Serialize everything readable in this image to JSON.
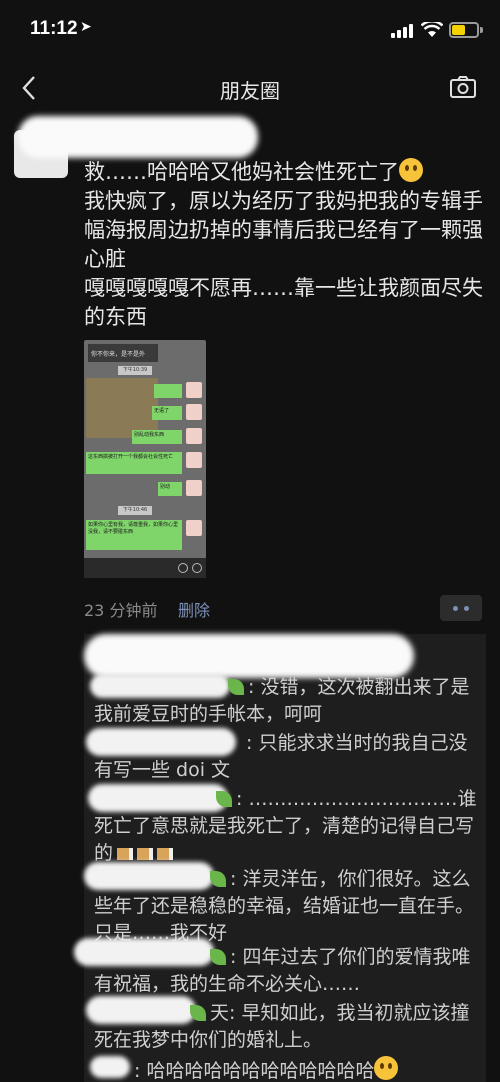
{
  "status_bar": {
    "time": "11:12"
  },
  "nav": {
    "title": "朋友圈"
  },
  "post": {
    "lines": [
      "救……哈哈哈又他妈社会性死亡了",
      "我快疯了，原以为经历了我妈把我的专辑手幅海报周边扔掉的事情后我已经有了一颗强心脏",
      "嘎嘎嘎嘎嘎不愿再……靠一些让我颜面尽失的东西"
    ],
    "image": {
      "top_text": "你不你来，是不是外",
      "time1": "下午10:39",
      "msg1": "无语了",
      "msg2": "别乱动我东西",
      "msg3": "这东西搞被打开一个我都会社会性死亡",
      "msg4": "别动",
      "time2": "下午10:46",
      "msg5": "如果你心里有我，请尊重我，如果你心里没我，请不要碰东西"
    },
    "time_ago": "23 分钟前",
    "delete_label": "删除"
  },
  "comments": [
    {
      "text": ": 没错，这次被翻出来了是我前爱豆时的手帐本，呵呵"
    },
    {
      "text": ": 只能求求当时的我自己没有写一些 doi 文"
    },
    {
      "text": ": ……………………………谁死亡了意思就是我死亡了，清楚的记得自己写的"
    },
    {
      "text": ": 洋灵洋缶，你们很好。这么些年了还是稳稳的幸福，结婚证也一直在手。只是……我不好"
    },
    {
      "text": ": 四年过去了你们的爱情我唯有祝福，我的生命不必关心……"
    },
    {
      "text": "天: 早知如此，我当初就应该撞死在我梦中你们的婚礼上。"
    },
    {
      "text": ": 哈哈哈哈哈哈哈哈哈哈哈哈"
    }
  ]
}
